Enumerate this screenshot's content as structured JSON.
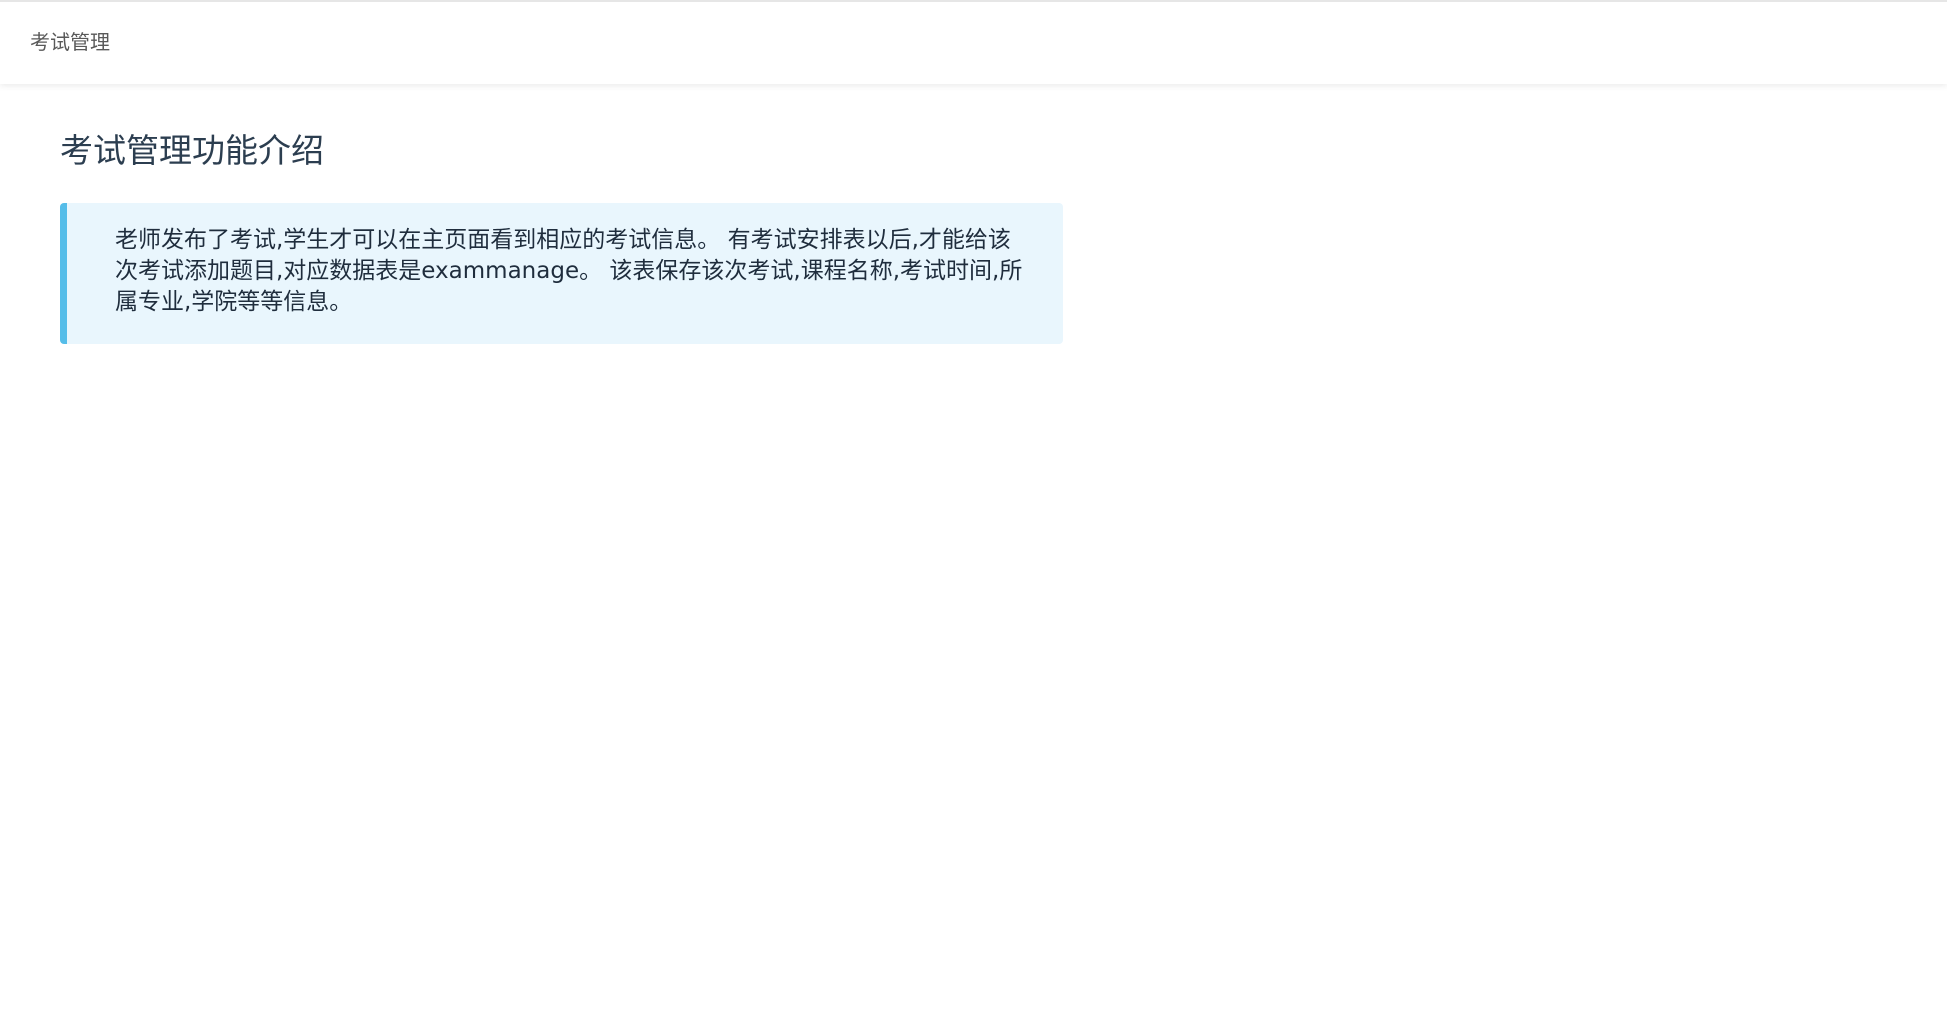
{
  "header": {
    "breadcrumb": "考试管理"
  },
  "main": {
    "title": "考试管理功能介绍",
    "description": "老师发布了考试,学生才可以在主页面看到相应的考试信息。 有考试安排表以后,才能给该次考试添加题目,对应数据表是exammanage。 该表保存该次考试,课程名称,考试时间,所属专业,学院等等信息。"
  },
  "colors": {
    "accent_border": "#55bde9",
    "info_background": "#e9f6fd",
    "title_text": "#2c3e50"
  }
}
